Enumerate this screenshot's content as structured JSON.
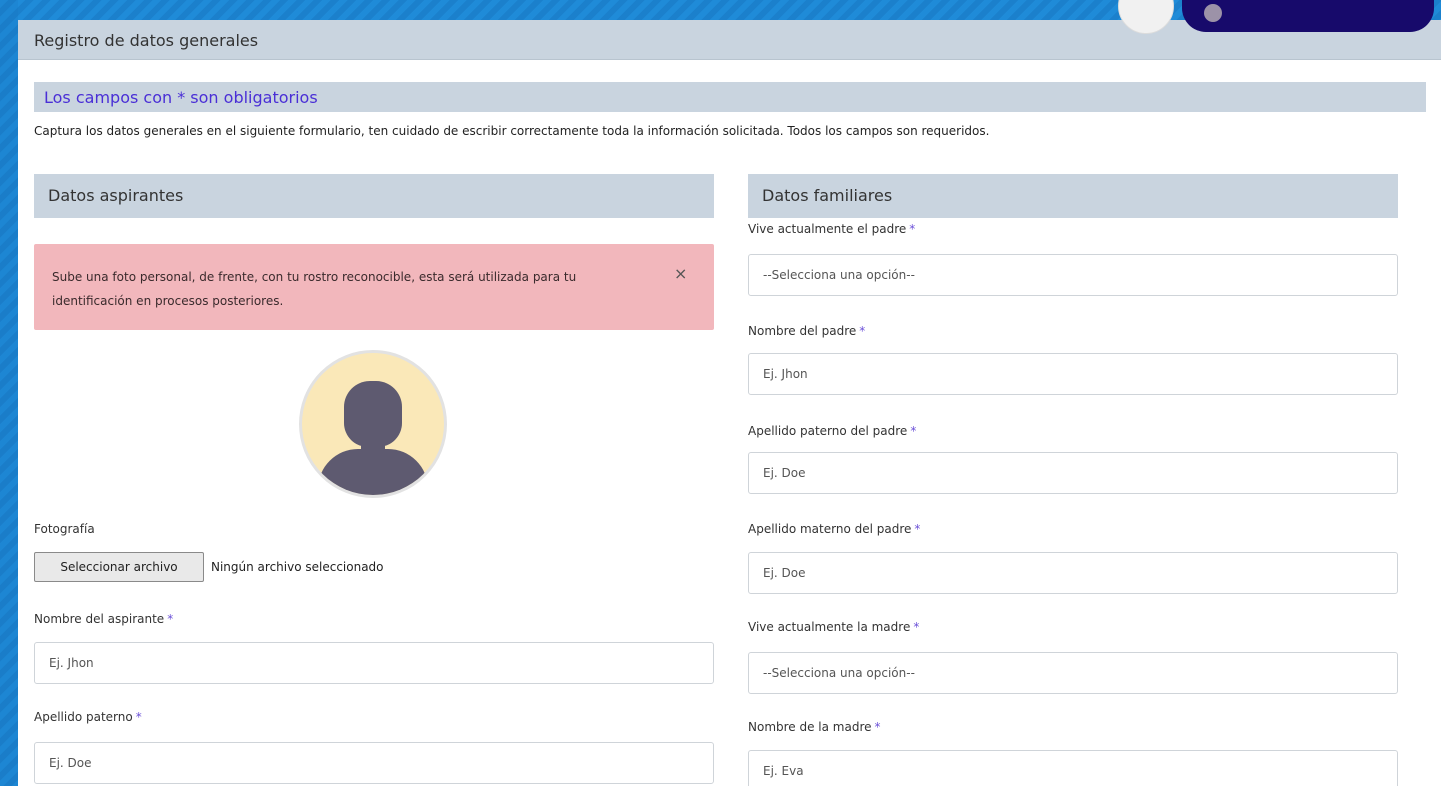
{
  "page": {
    "title": "Registro de datos generales",
    "notice": "Los campos con * son obligatorios",
    "intro": "Captura los datos generales en el siguiente formulario, ten cuidado de escribir correctamente toda la información solicitada. Todos los campos son requeridos."
  },
  "left": {
    "section_title": "Datos aspirantes",
    "alert": {
      "text": "Sube una foto personal, de frente, con tu rostro reconocible, esta será utilizada para tu identificación en procesos posteriores.",
      "close": "×"
    },
    "photo": {
      "label": "Fotografía",
      "button": "Seleccionar archivo",
      "status": "Ningún archivo seleccionado"
    },
    "fields": [
      {
        "label": "Nombre del aspirante",
        "required": "*",
        "placeholder": "Ej. Jhon"
      },
      {
        "label": "Apellido paterno",
        "required": "*",
        "placeholder": "Ej. Doe"
      }
    ]
  },
  "right": {
    "section_title": "Datos familiares",
    "fields": [
      {
        "label": "Vive actualmente el padre",
        "required": "*",
        "value": "--Selecciona una opción--",
        "type": "select"
      },
      {
        "label": "Nombre del padre",
        "required": "*",
        "placeholder": "Ej. Jhon"
      },
      {
        "label": "Apellido paterno del padre",
        "required": "*",
        "placeholder": "Ej. Doe"
      },
      {
        "label": "Apellido materno del padre",
        "required": "*",
        "placeholder": "Ej. Doe"
      },
      {
        "label": "Vive actualmente la madre",
        "required": "*",
        "value": "--Selecciona una opción--",
        "type": "select"
      },
      {
        "label": "Nombre de la madre",
        "required": "*",
        "placeholder": "Ej. Eva"
      }
    ]
  },
  "icons": {
    "close": "close-icon",
    "avatar": "user-silhouette-icon"
  },
  "colors": {
    "header_bg": "#c9d4df",
    "notice_text": "#4a2fd6",
    "alert_bg": "#f2b7bc",
    "page_bg": "#1a7fcf",
    "user_pill": "#170a6b"
  }
}
